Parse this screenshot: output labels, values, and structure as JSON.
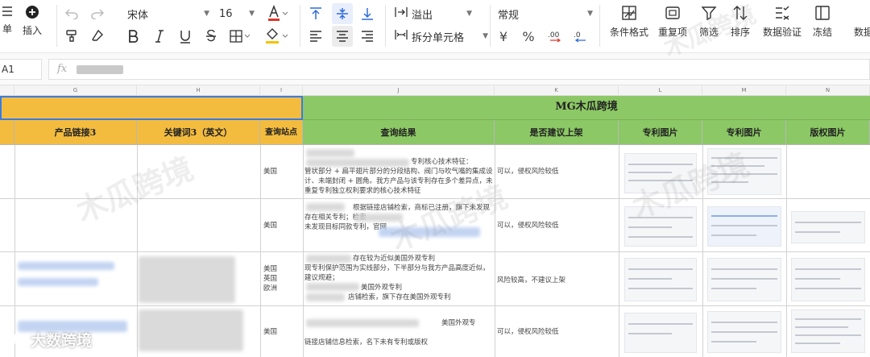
{
  "toolbar": {
    "list_label": "单",
    "insert_label": "插入",
    "font_name": "宋体",
    "font_size": "16",
    "overflow_label": "溢出",
    "merge_label": "拆分单元格",
    "number_format": "常规",
    "currency_symbol": "¥",
    "percent_symbol": "%",
    "cond_format_label": "条件格式",
    "duplicate_label": "重复项",
    "filter_label": "筛选",
    "sort_label": "排序",
    "validation_label": "数据验证",
    "freeze_label": "冻结",
    "data_label": "数据"
  },
  "formula_bar": {
    "cell_ref": "A1",
    "fx_label": "fx"
  },
  "columns": [
    "G",
    "H",
    "I",
    "J",
    "K",
    "L",
    "M",
    "N"
  ],
  "sheet": {
    "group_title": "MG木瓜跨境",
    "headers": {
      "product_link": "产品链接3",
      "keyword": "关键词3（英文）",
      "site": "查询站点",
      "result": "查询结果",
      "recommend": "是否建议上架",
      "patent1": "专利图片",
      "patent2": "专利图片",
      "copyright": "版权图片"
    },
    "rows": [
      {
        "site": "美国",
        "result_lines": [
          "专利核心技术特征：",
          "管状部分 + 扁平翅片部分的分段结构、阀门与吹气嘴的集成设",
          "计、未端封闭 + 圆角。我方产品与该专利存在多个差异点，未",
          "重复专利独立权利要求的核心技术特征"
        ],
        "recommend": "可以，侵权风险较低"
      },
      {
        "site": "美国",
        "result_lines": [
          "根据链接店铺检索，商标已注册，旗下未发现",
          "存在相关专利；检索",
          "未发现目标同款专利，官网"
        ],
        "recommend": "可以，侵权风险较低"
      },
      {
        "site_lines": [
          "美国",
          "英国",
          "欧洲"
        ],
        "result_lines": [
          "存在较为近似美国外观专利",
          "现专利保护范围为实线部分，下半部分与我方产品高度近似，",
          "建议规避；",
          "美国外观专利",
          "店铺检索，旗下存在美国外观专利"
        ],
        "recommend": "风险较高，不建议上架"
      },
      {
        "site": "美国",
        "result_lines": [
          "美国外观专",
          "链接店铺信息检索，名下未有专利或版权"
        ],
        "recommend": "可以，侵权风险较低"
      }
    ]
  },
  "watermarks": [
    "木瓜跨境",
    "木瓜跨境",
    "木瓜跨境",
    "木瓜跨境"
  ],
  "brand": {
    "name": "大数跨境"
  },
  "colors": {
    "yellow_header": "#f3bc3f",
    "green_header": "#8cc865",
    "selection": "#3a7be3"
  }
}
